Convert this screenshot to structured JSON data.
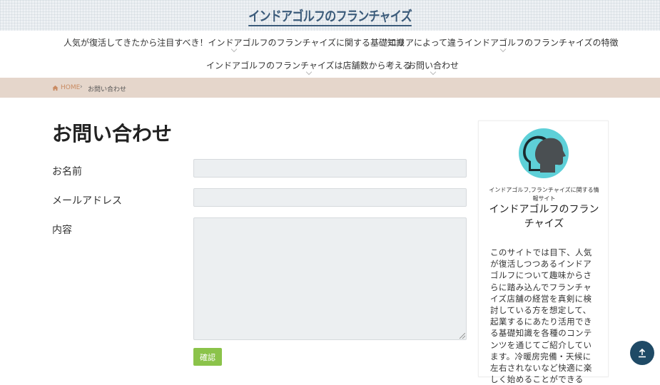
{
  "header": {
    "logo_text": "インドアゴルフのフランチャイズ"
  },
  "nav": {
    "items": [
      {
        "label": "人気が復活してきたから注目すべき！インドアゴルフのフランチャイズに関する基礎知識"
      },
      {
        "label": "エリアによって違うインドアゴルフのフランチャイズの特徴"
      },
      {
        "label": "インドアゴルフのフランチャイズは店舗数から考える"
      },
      {
        "label": "お問い合わせ"
      }
    ]
  },
  "breadcrumb": {
    "home": "HOME",
    "current": "お問い合わせ"
  },
  "main": {
    "title": "お問い合わせ",
    "form": {
      "name_label": "お名前",
      "email_label": "メールアドレス",
      "content_label": "内容",
      "name_value": "",
      "email_value": "",
      "content_value": "",
      "submit_label": "確認"
    }
  },
  "sidebar": {
    "subtitle": "インドアゴルフ,フランチャイズに関する情報サイト",
    "title": "インドアゴルフのフランチャイズ",
    "description": "このサイトでは目下、人気が復活しつつあるインドアゴルフについて趣味からさらに踏み込んでフランチャイズ店舗の経営を真剣に検討している方を想定して、起業するにあたり活用できる基礎知識を各種のコンテンツを通じてご紹介しています。冷暖房完備・天候に左右されないなど快適に楽しく始めることができる"
  },
  "colors": {
    "accent": "#8bc34a",
    "breadcrumb_bg": "#e5d6cb",
    "to_top": "#1f4a66",
    "avatar": "#5ed0d8"
  },
  "icons": {
    "home": "home-icon",
    "to_top": "arrow-up-icon",
    "avatar": "two-heads-icon"
  }
}
